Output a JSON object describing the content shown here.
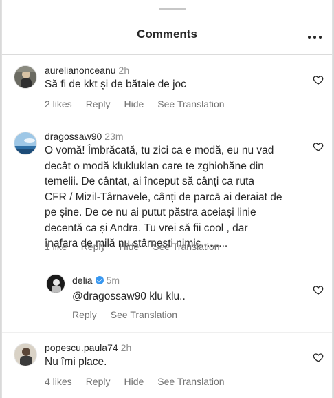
{
  "header": {
    "title": "Comments"
  },
  "comments": [
    {
      "username": "aurelianonceanu",
      "time": "2h",
      "lines": [
        "Să fi de kkt și de bătaie de joc"
      ],
      "likes": "2 likes",
      "reply": "Reply",
      "hide": "Hide",
      "translate": "See Translation"
    },
    {
      "username": "dragossaw90",
      "time": "23m",
      "lines": [
        "O vomă! Îmbrăcată,  tu zici ca e modă, eu nu vad",
        "decât o modă klukluklan care te zghiohăne din",
        "temelii. De cântat, ai început să cânți ca ruta",
        "CFR / Mizil-Târnavele, cânți de parcă ai deraiat de",
        "pe șine. De ce nu ai putut păstra aceiași linie",
        "decentă ca și Andra. Tu vrei să fii cool , dar",
        "înafara de milă nu stârnești nimic........."
      ],
      "likes": "1 like",
      "reply": "Reply",
      "hide": "Hide",
      "translate": "See Translation"
    },
    {
      "username": "delia",
      "time": "5m",
      "lines": [
        "@dragossaw90 klu klu.."
      ],
      "reply": "Reply",
      "translate": "See Translation"
    },
    {
      "username": "popescu.paula74",
      "time": "2h",
      "lines": [
        "Nu îmi place."
      ],
      "likes": "4 likes",
      "reply": "Reply",
      "hide": "Hide",
      "translate": "See Translation"
    }
  ]
}
